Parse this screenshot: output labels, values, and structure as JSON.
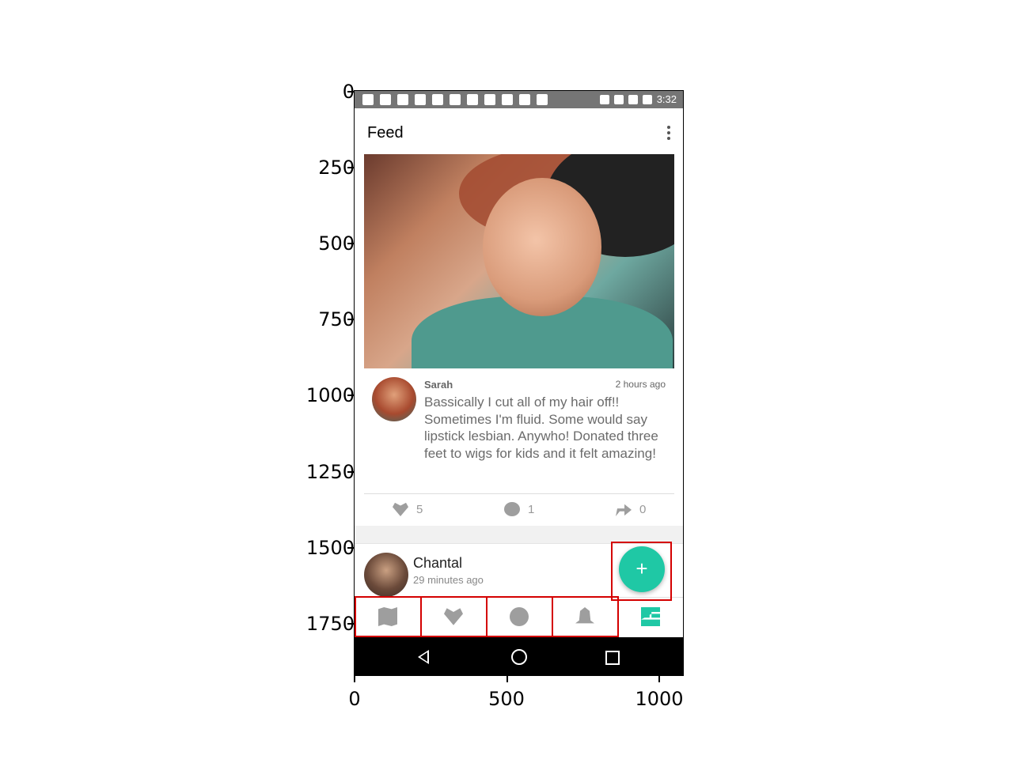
{
  "axes": {
    "y_ticks": [
      "0",
      "250",
      "500",
      "750",
      "1000",
      "1250",
      "1500",
      "1750"
    ],
    "x_ticks": [
      "0",
      "500",
      "1000"
    ]
  },
  "status_bar": {
    "time": "3:32"
  },
  "app_bar": {
    "title": "Feed",
    "overflow_icon": "more-vert-icon"
  },
  "post": {
    "author": "Sarah",
    "time": "2 hours ago",
    "text": "Bassically I cut all of my hair off!! Sometimes I'm fluid. Some would say lipstick lesbian. Anywho! Donated three feet to wigs for kids and it felt amazing!",
    "likes": "5",
    "comments": "1",
    "shares": "0"
  },
  "next_post": {
    "author": "Chantal",
    "time": "29 minutes ago"
  },
  "fab": {
    "label": "+"
  },
  "bottom_nav": {
    "items": [
      {
        "name": "map-icon"
      },
      {
        "name": "heart-icon"
      },
      {
        "name": "chat-icon"
      },
      {
        "name": "bell-icon"
      },
      {
        "name": "feed-icon",
        "active": true
      }
    ],
    "accent_color": "#1fc8a5"
  },
  "annotation_color": "#d40000"
}
